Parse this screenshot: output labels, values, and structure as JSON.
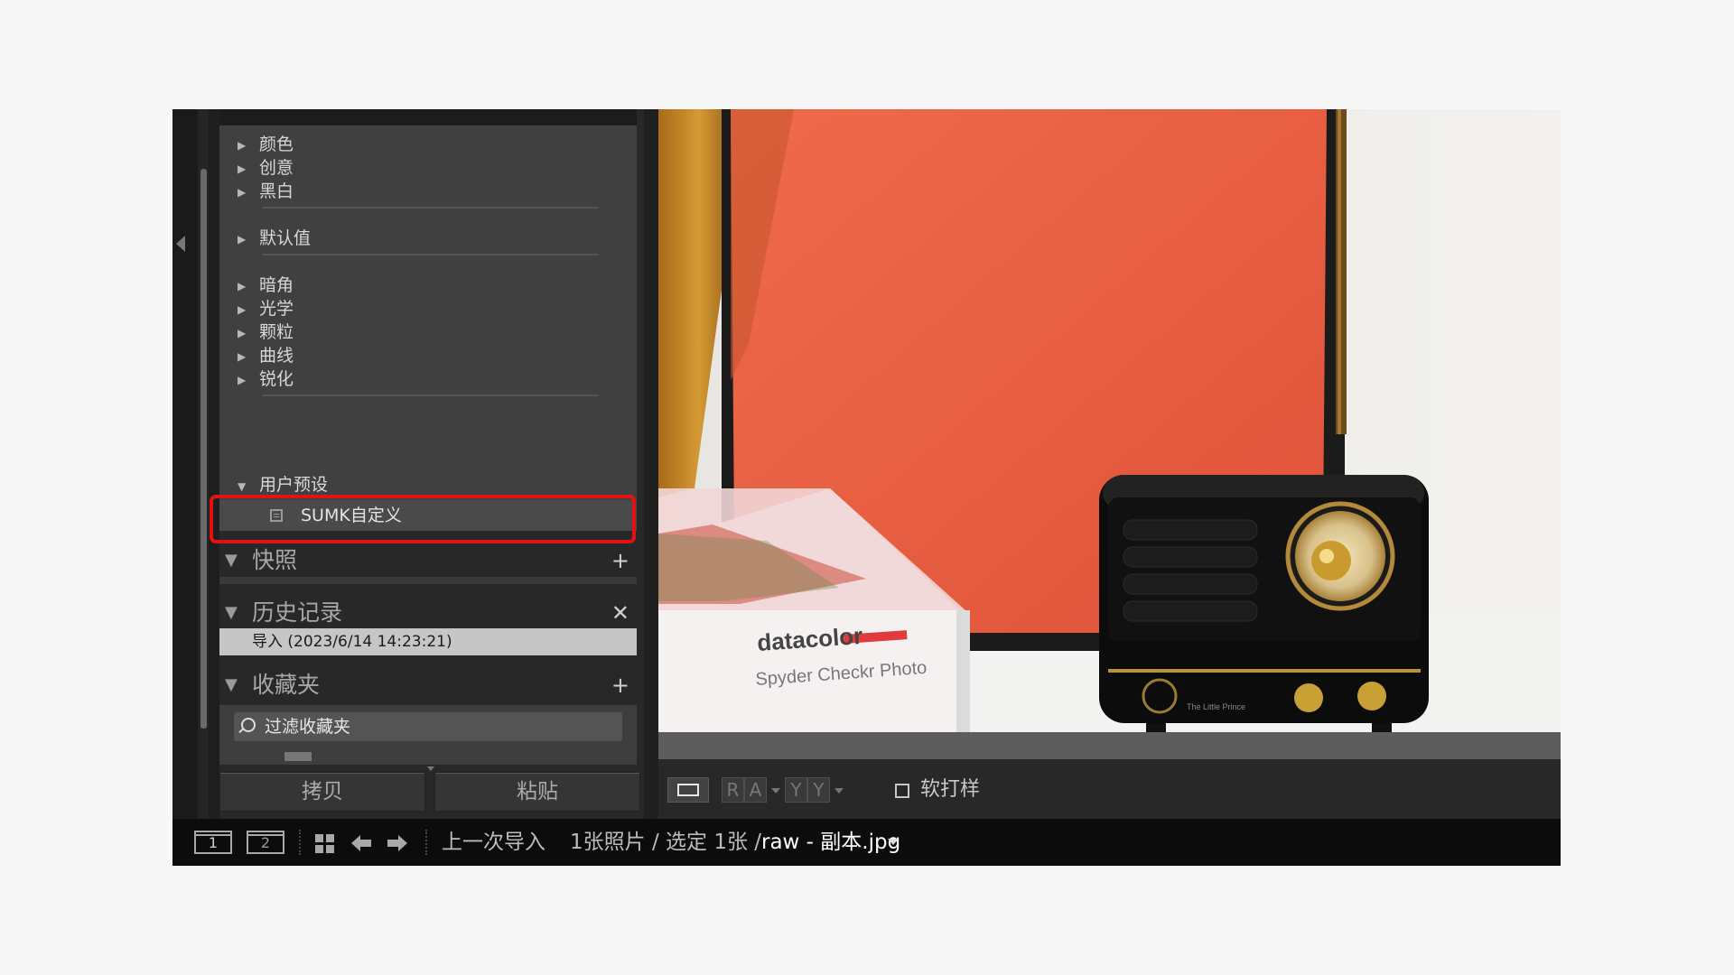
{
  "presets": {
    "items": [
      {
        "label": "颜色"
      },
      {
        "label": "创意"
      },
      {
        "label": "黑白"
      },
      {
        "label": "默认值"
      },
      {
        "label": "暗角"
      },
      {
        "label": "光学"
      },
      {
        "label": "颗粒"
      },
      {
        "label": "曲线"
      },
      {
        "label": "锐化"
      }
    ],
    "user_group": "用户预设",
    "user_preset_selected": "SUMK自定义"
  },
  "snapshots": {
    "title": "快照",
    "action": "+"
  },
  "history": {
    "title": "历史记录",
    "action": "✕",
    "entry": "导入 (2023/6/14 14:23:21)"
  },
  "collections": {
    "title": "收藏夹",
    "action": "+",
    "filter_label": "过滤收藏夹"
  },
  "buttons": {
    "copy": "拷贝",
    "paste": "粘贴"
  },
  "toolbar": {
    "view_a": "R",
    "view_b": "A",
    "view_c": "Y",
    "view_d": "Y",
    "softproof_label": "软打样",
    "softproof_checked": false
  },
  "filmstrip": {
    "monitor1": "1",
    "monitor2": "2",
    "source": "上一次导入",
    "count": "1张照片 / 选定 1张 /",
    "filename": "raw - 副本.jpg"
  },
  "photo": {
    "brand": "datacolor",
    "product": "Spyder Checkr Photo",
    "radio_brand": "The Little Prince"
  },
  "colors": {
    "highlight": "#e31212",
    "panel_bg": "#404040",
    "selected_row": "#4a4a4a"
  }
}
